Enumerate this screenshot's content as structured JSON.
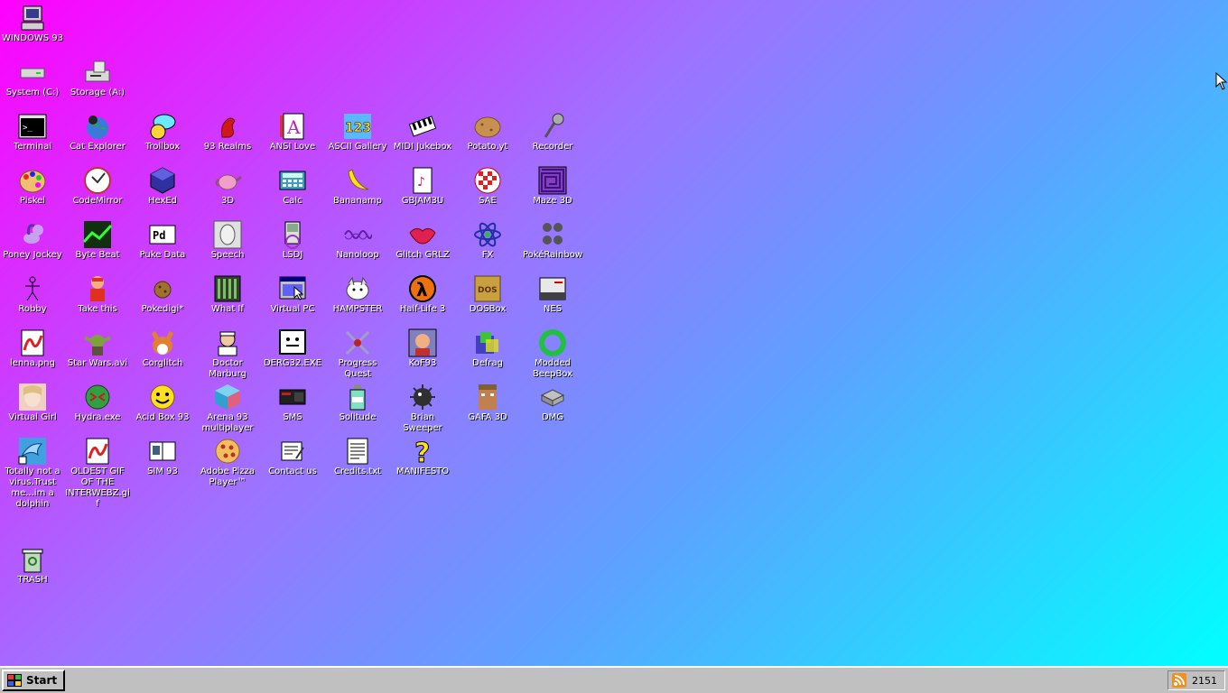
{
  "taskbar": {
    "start_label": "Start",
    "clock": "2151"
  },
  "desktop_icons": [
    {
      "label": "WINDOWS 93",
      "icon": "computer-icon"
    },
    {
      "label": "System (C:)",
      "icon": "hard-drive-icon"
    },
    {
      "label": "Storage (A:)",
      "icon": "floppy-drive-icon"
    },
    {
      "label": "Terminal",
      "icon": "terminal-icon"
    },
    {
      "label": "Cat Explorer",
      "icon": "cat-globe-icon"
    },
    {
      "label": "Trollbox",
      "icon": "chat-bubble-icon"
    },
    {
      "label": "93 Realms",
      "icon": "dragon-icon"
    },
    {
      "label": "ANSI Love",
      "icon": "ansi-letter-icon"
    },
    {
      "label": "ASCII Gallery",
      "icon": "number-blocks-icon"
    },
    {
      "label": "MIDI Jukebox",
      "icon": "piano-keys-icon"
    },
    {
      "label": "Potato.yt",
      "icon": "potato-icon"
    },
    {
      "label": "Recorder",
      "icon": "microphone-icon"
    },
    {
      "label": "Piskel",
      "icon": "paint-palette-icon"
    },
    {
      "label": "CodeMirror",
      "icon": "codemirror-icon"
    },
    {
      "label": "HexEd",
      "icon": "hex-cube-icon"
    },
    {
      "label": "3D",
      "icon": "teapot-icon"
    },
    {
      "label": "Calc",
      "icon": "calculator-icon"
    },
    {
      "label": "Bananamp",
      "icon": "banana-icon"
    },
    {
      "label": "GBJAM3U",
      "icon": "music-file-icon"
    },
    {
      "label": "SAE",
      "icon": "checkered-ball-icon"
    },
    {
      "label": "Maze 3D",
      "icon": "maze-icon"
    },
    {
      "label": "Poney Jockey",
      "icon": "pony-icon"
    },
    {
      "label": "Byte Beat",
      "icon": "byte-beat-icon"
    },
    {
      "label": "Puke Data",
      "icon": "pd-icon"
    },
    {
      "label": "Speech",
      "icon": "speech-face-icon"
    },
    {
      "label": "LSDJ",
      "icon": "gameboy-icon"
    },
    {
      "label": "Nanoloop",
      "icon": "waveform-icon"
    },
    {
      "label": "Glitch GRLZ",
      "icon": "lips-icon"
    },
    {
      "label": "FX",
      "icon": "atom-icon"
    },
    {
      "label": "PokéRainbow",
      "icon": "pokemon-trainers-icon"
    },
    {
      "label": "Robby",
      "icon": "stick-figure-icon"
    },
    {
      "label": "Take this",
      "icon": "character-icon"
    },
    {
      "label": "Pokedigi*",
      "icon": "cookie-monster-icon"
    },
    {
      "label": "What If",
      "icon": "film-strip-icon"
    },
    {
      "label": "Virtual PC",
      "icon": "window-cursor-icon"
    },
    {
      "label": "HAMPSTER",
      "icon": "hamster-icon"
    },
    {
      "label": "Half-Life 3",
      "icon": "lambda-icon"
    },
    {
      "label": "DOSBox",
      "icon": "dosbox-icon"
    },
    {
      "label": "NES",
      "icon": "nes-console-icon"
    },
    {
      "label": "lenna.png",
      "icon": "image-file-icon"
    },
    {
      "label": "Star Wars.avi",
      "icon": "yoda-icon"
    },
    {
      "label": "Corglitch",
      "icon": "corgi-icon"
    },
    {
      "label": "Doctor Marburg",
      "icon": "doctor-icon"
    },
    {
      "label": "DERG32.EXE",
      "icon": "monitor-face-icon"
    },
    {
      "label": "Progress Quest",
      "icon": "swords-icon"
    },
    {
      "label": "KoF93",
      "icon": "fighter-portrait-icon"
    },
    {
      "label": "Defrag",
      "icon": "defrag-icon"
    },
    {
      "label": "Modded BeepBox",
      "icon": "green-ring-icon"
    },
    {
      "label": "Virtual Girl",
      "icon": "girl-portrait-icon"
    },
    {
      "label": "Hydra.exe",
      "icon": "hydra-icon"
    },
    {
      "label": "Acid Box 93",
      "icon": "smiley-icon"
    },
    {
      "label": "Arena 93 multiplayer",
      "icon": "cube-icon"
    },
    {
      "label": "SMS",
      "icon": "sms-console-icon"
    },
    {
      "label": "Solitude",
      "icon": "potion-bottle-icon"
    },
    {
      "label": "Brian Sweeper",
      "icon": "mine-icon"
    },
    {
      "label": "GAFA 3D",
      "icon": "doom-face-icon"
    },
    {
      "label": "DMG",
      "icon": "dmg-disk-icon"
    },
    {
      "label": "Totally not a virus.Trust me...im a dolphin",
      "icon": "dolphin-icon"
    },
    {
      "label": "OLDEST GIF OF THE INTERWEBZ.gif",
      "icon": "gif-file-icon"
    },
    {
      "label": "SIM 93",
      "icon": "book-icon"
    },
    {
      "label": "Adobe Pizza Player™",
      "icon": "pizza-icon"
    },
    {
      "label": "Contact us",
      "icon": "contact-note-icon"
    },
    {
      "label": "Credits.txt",
      "icon": "text-file-icon"
    },
    {
      "label": "MANIFESTO",
      "icon": "question-mark-icon"
    },
    {
      "label": "TRASH",
      "icon": "trash-icon"
    }
  ]
}
